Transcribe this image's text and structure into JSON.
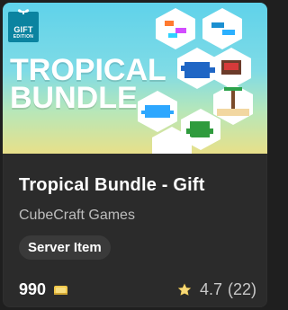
{
  "product": {
    "badge": {
      "line1": "GIFT",
      "line2": "EDITION"
    },
    "headline": {
      "line1": "TROPICAL",
      "line2": "BUNDLE"
    },
    "title": "Tropical Bundle - Gift",
    "publisher": "CubeCraft Games",
    "tag": "Server Item",
    "price": "990",
    "rating": {
      "value": "4.7",
      "count": "(22)"
    },
    "icons": {
      "currency": "coin-icon",
      "rating": "star-icon",
      "gift": "gift-bow-icon"
    },
    "colors": {
      "card_bg": "#2b2b2b",
      "page_bg": "#1f1f1f",
      "badge_bg": "#0b83a0",
      "gold": "#f2c94c"
    }
  }
}
